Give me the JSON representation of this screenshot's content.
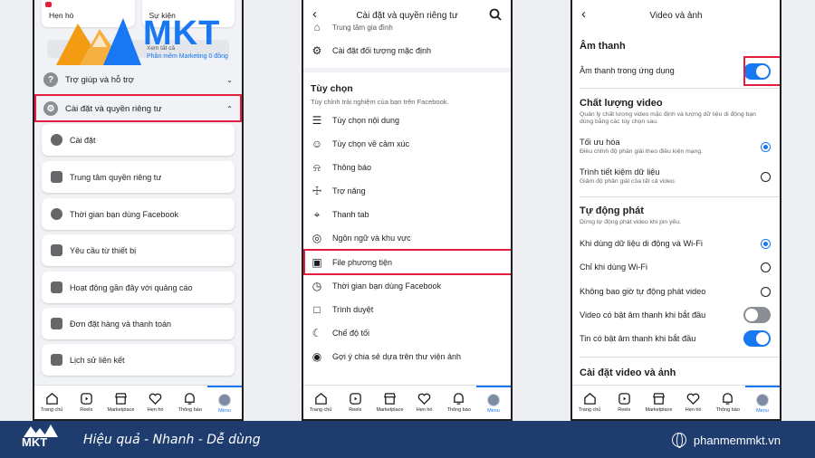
{
  "colors": {
    "brand_blue": "#1877f2",
    "highlight_red": "#e41e3f",
    "footer_bg": "#1e3c6e"
  },
  "nav": [
    "Trang chủ",
    "Reels",
    "Marketplace",
    "Hẹn hò",
    "Thông báo",
    "Menu"
  ],
  "phone1": {
    "top_cards": [
      "Hẹn hò",
      "Sự kiện"
    ],
    "logo": {
      "text": "MKT",
      "tag": "Phần mềm Marketing 0 đồng",
      "hidden_label": "Xem tất cả"
    },
    "help": {
      "label": "Trợ giúp và hỗ trợ",
      "icon": "question-icon"
    },
    "settings": {
      "label": "Cài đặt và quyền riêng tư",
      "icon": "gear-icon"
    },
    "items": [
      {
        "label": "Cài đặt",
        "icon": "user-circle-icon"
      },
      {
        "label": "Trung tâm quyền riêng tư",
        "icon": "lock-user-icon"
      },
      {
        "label": "Thời gian bạn dùng Facebook",
        "icon": "clock-icon"
      },
      {
        "label": "Yêu cầu từ thiết bị",
        "icon": "device-icon"
      },
      {
        "label": "Hoạt động gần đây với quảng cáo",
        "icon": "ad-icon"
      },
      {
        "label": "Đơn đặt hàng và thanh toán",
        "icon": "tag-icon"
      },
      {
        "label": "Lịch sử liên kết",
        "icon": "link-icon"
      }
    ]
  },
  "phone2": {
    "title": "Cài đặt và quyền riêng tư",
    "top_cut": "Trung tâm gia đình",
    "default_audience": "Cài đặt đối tượng mặc định",
    "pref_heading": "Tùy chọn",
    "pref_desc": "Tùy chỉnh trải nghiệm của bạn trên Facebook.",
    "items": [
      {
        "label": "Tùy chọn nội dung",
        "icon": "sliders-icon"
      },
      {
        "label": "Tùy chọn về cảm xúc",
        "icon": "emoji-icon"
      },
      {
        "label": "Thông báo",
        "icon": "bell-icon"
      },
      {
        "label": "Trợ năng",
        "icon": "accessibility-icon"
      },
      {
        "label": "Thanh tab",
        "icon": "pin-icon"
      },
      {
        "label": "Ngôn ngữ và khu vực",
        "icon": "globe-icon"
      },
      {
        "label": "File phương tiện",
        "icon": "media-file-icon"
      },
      {
        "label": "Thời gian bạn dùng Facebook",
        "icon": "clock-icon"
      },
      {
        "label": "Trình duyệt",
        "icon": "browser-icon"
      },
      {
        "label": "Chế độ tối",
        "icon": "moon-icon"
      },
      {
        "label": "Gợi ý chia sẻ dựa trên thư viện ảnh",
        "icon": "camera-icon"
      }
    ]
  },
  "phone3": {
    "title": "Video và ảnh",
    "sound_heading": "Âm thanh",
    "sound_label": "Âm thanh trong ứng dụng",
    "quality_heading": "Chất lượng video",
    "quality_desc": "Quản lý chất lượng video mặc định và lượng dữ liệu di động bạn dùng bằng các tùy chọn sau.",
    "opt_optimize": "Tối ưu hóa",
    "opt_optimize_desc": "Điều chỉnh độ phân giải theo điều kiện mạng.",
    "opt_saver": "Trình tiết kiệm dữ liệu",
    "opt_saver_desc": "Giảm độ phân giải của tất cả video.",
    "autoplay_heading": "Tự động phát",
    "autoplay_desc": "Dừng tự động phát video khi pin yếu.",
    "opt_mobile": "Khi dùng dữ liệu di động và Wi-Fi",
    "opt_wifi": "Chỉ khi dùng Wi-Fi",
    "opt_never": "Không bao giờ tự động phát video",
    "video_sound": "Video có bật âm thanh khi bắt đầu",
    "story_sound": "Tin có bật âm thanh khi bắt đầu",
    "settings_heading": "Cài đặt video và ảnh"
  },
  "footer": {
    "logo": "MKT",
    "slogan": "Hiệu quả - Nhanh - Dễ dùng",
    "website": "phanmemmkt.vn"
  }
}
